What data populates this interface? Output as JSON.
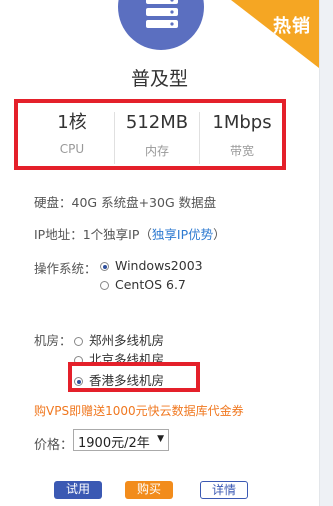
{
  "badge": "热销",
  "title": "普及型",
  "specs": [
    {
      "value": "1核",
      "label": "CPU"
    },
    {
      "value": "512MB",
      "label": "内存"
    },
    {
      "value": "1Mbps",
      "label": "带宽"
    }
  ],
  "disk": "硬盘：40G 系统盘+30G 数据盘",
  "ip_prefix": "IP地址：1个独享IP（",
  "ip_link": "独享IP优势",
  "ip_suffix": "）",
  "os": {
    "label": "操作系统：",
    "options": [
      {
        "name": "Windows2003",
        "selected": true
      },
      {
        "name": "CentOS 6.7",
        "selected": false
      }
    ]
  },
  "room": {
    "label": "机房：",
    "options": [
      {
        "name": "郑州多线机房",
        "selected": false
      },
      {
        "name": "北京多线机房",
        "selected": false
      },
      {
        "name": "香港多线机房",
        "selected": true
      }
    ]
  },
  "promo": "购VPS即赠送1000元快云数据库代金券",
  "price": {
    "label": "价格：",
    "selected": "1900元/2年"
  },
  "buttons": {
    "try": "试用",
    "buy": "购买",
    "detail": "详情"
  },
  "colors": {
    "accent": "#3b59b3",
    "orange": "#f28c1c",
    "highlight": "#e4202a",
    "link": "#2f7bd1"
  }
}
